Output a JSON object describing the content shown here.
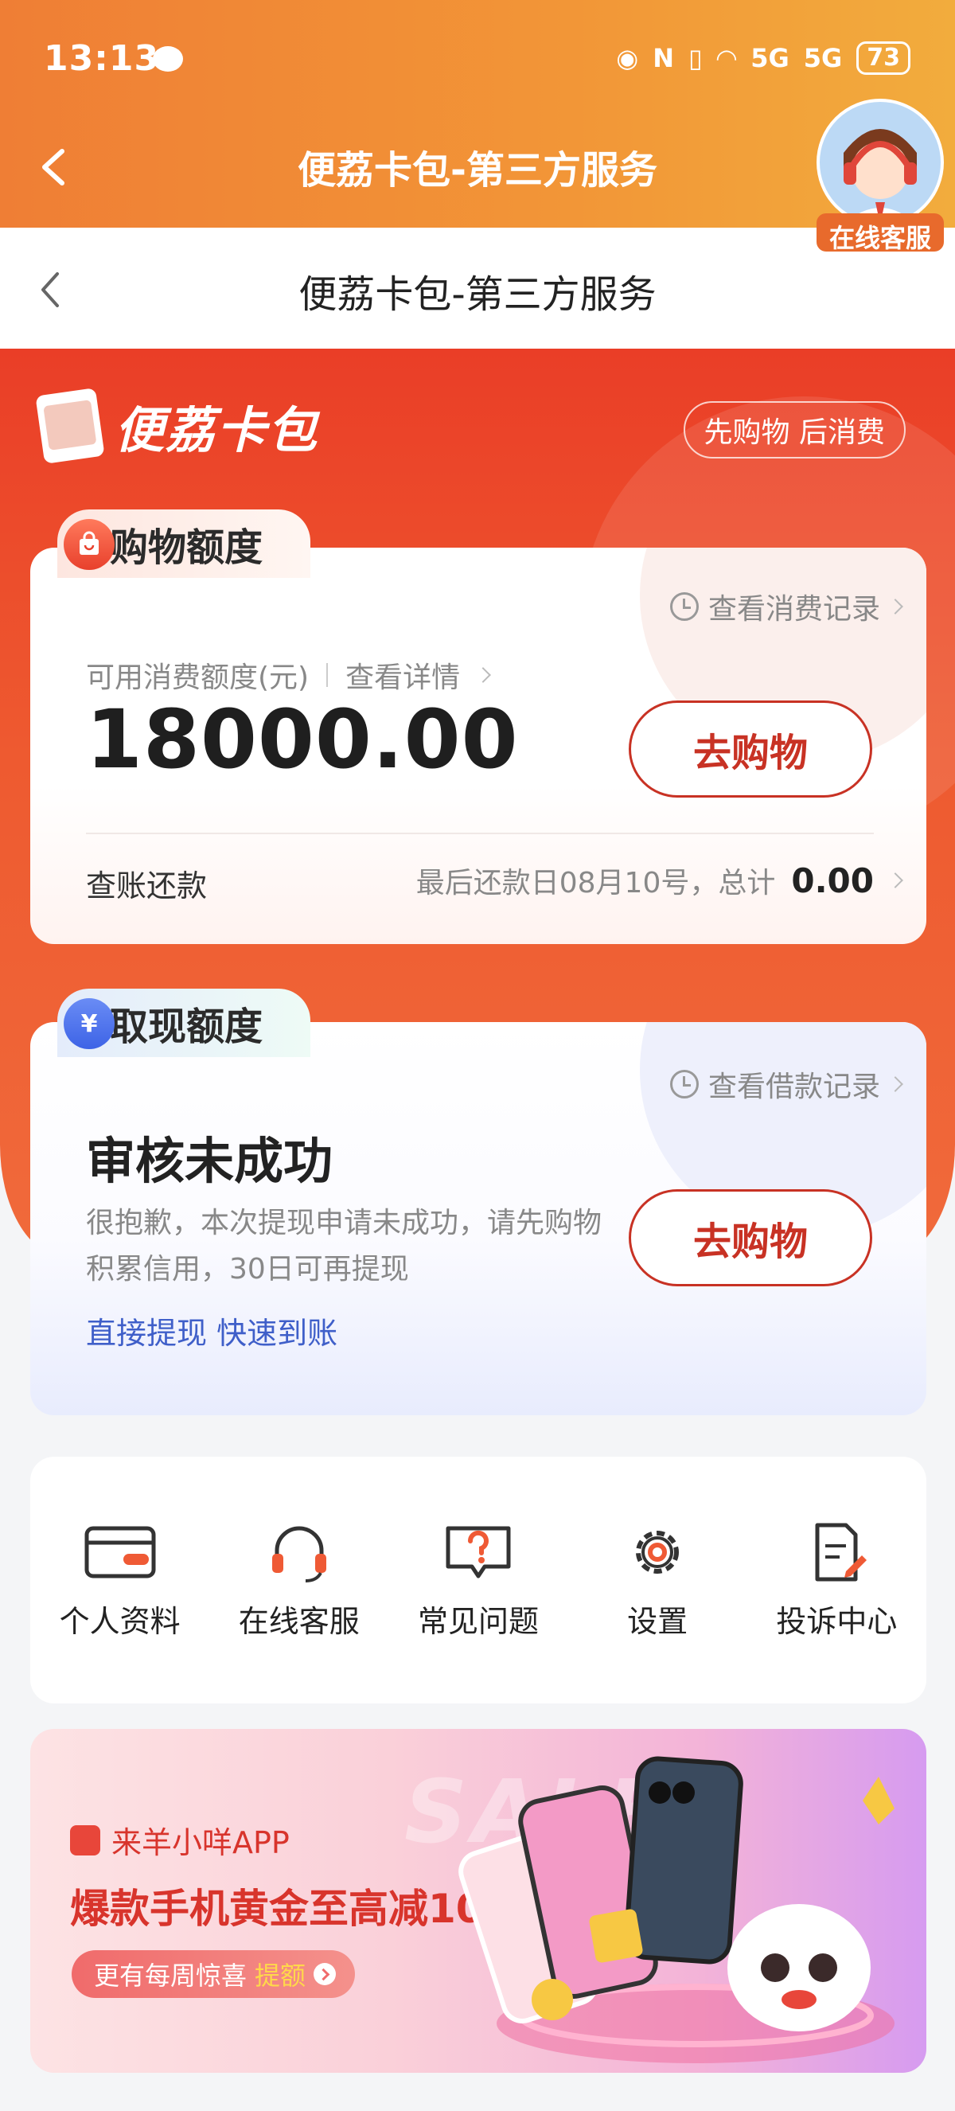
{
  "status_bar": {
    "time": "13:13",
    "signal1": "5G",
    "signal2": "5G",
    "battery": "73"
  },
  "navbar": {
    "title": "便荔卡包-第三方服务"
  },
  "service_badge": {
    "label": "在线客服"
  },
  "webbar": {
    "title": "便荔卡包-第三方服务"
  },
  "brand": {
    "name": "便荔卡包",
    "slogan": "先购物 后消费"
  },
  "shopping": {
    "tab": "购物额度",
    "record_link": "查看消费记录",
    "limit_label": "可用消费额度(元)",
    "details_link": "查看详情",
    "amount": "18000.00",
    "button": "去购物",
    "bill_label": "查账还款",
    "bill_info": "最后还款日08月10号，总计",
    "bill_total": "0.00"
  },
  "cash": {
    "tab": "取现额度",
    "tab_icon_glyph": "¥",
    "record_link": "查看借款记录",
    "title": "审核未成功",
    "description": "很抱歉，本次提现申请未成功，请先购物积累信用，30日可再提现",
    "button": "去购物",
    "fast_link": "直接提现 快速到账"
  },
  "menu": [
    {
      "label": "个人资料",
      "icon": "card-icon"
    },
    {
      "label": "在线客服",
      "icon": "headset-icon"
    },
    {
      "label": "常见问题",
      "icon": "question-icon"
    },
    {
      "label": "设置",
      "icon": "gear-icon"
    },
    {
      "label": "投诉中心",
      "icon": "complaint-icon"
    }
  ],
  "banner": {
    "app_name": "来羊小咩APP",
    "headline": "爆款手机黄金至高减1000元",
    "pill_text": "更有每周惊喜",
    "pill_highlight": "提额",
    "bg_text": "SALE"
  },
  "colors": {
    "accent_red": "#c83224",
    "orange": "#f29637",
    "link_blue": "#3f5fc9"
  }
}
